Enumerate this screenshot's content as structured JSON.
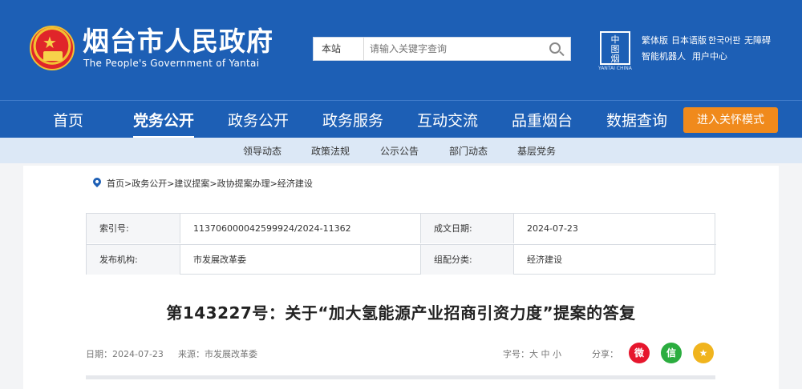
{
  "header": {
    "title": "烟台市人民政府",
    "subtitle": "The People's Government of Yantai",
    "search": {
      "scope": "本站",
      "placeholder": "请输入关键字查询"
    },
    "seal_text": "中\n圖\n烟\n台",
    "seal_caption": "YANTAI CHINA",
    "quick_links_row1": [
      "繁体版",
      "日本语版",
      "한국어판",
      "无障碍"
    ],
    "quick_links_row2": [
      "智能机器人",
      "用户中心"
    ]
  },
  "nav": {
    "items": [
      "首页",
      "党务公开",
      "政务公开",
      "政务服务",
      "互动交流",
      "品重烟台",
      "数据查询"
    ],
    "active_index": 1,
    "care_button": "进入关怀模式"
  },
  "subnav": {
    "items": [
      "领导动态",
      "政策法规",
      "公示公告",
      "部门动态",
      "基层党务"
    ]
  },
  "breadcrumb": "首页>政务公开>建议提案>政协提案办理>经济建设",
  "meta": {
    "index_label": "索引号:",
    "index_value": "113706000042599924/2024-11362",
    "date_label": "成文日期:",
    "date_value": "2024-07-23",
    "org_label": "发布机构:",
    "org_value": "市发展改革委",
    "category_label": "组配分类:",
    "category_value": "经济建设"
  },
  "document": {
    "title": "第143227号：关于“加大氢能源产业招商引资力度”提案的答复",
    "date": "日期：2024-07-23",
    "source": "来源：市发展改革委",
    "font_size": "字号：大 中 小",
    "share_label": "分享："
  },
  "colors": {
    "brand_blue": "#1d5fb5",
    "care_orange": "#f08a1c",
    "weibo_red": "#e6162d",
    "wechat_green": "#2bad3f",
    "favorite_gold": "#f0b41e"
  }
}
